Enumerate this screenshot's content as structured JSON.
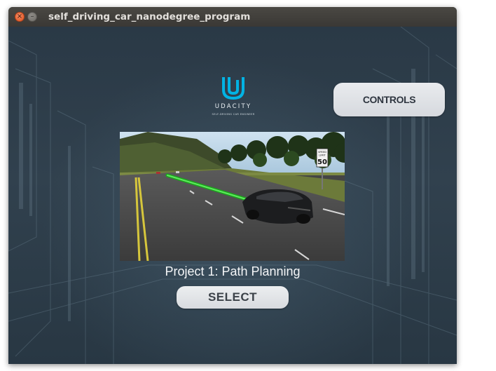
{
  "window": {
    "title": "self_driving_car_nanodegree_program",
    "close_glyph": "×",
    "minimize_glyph": "–"
  },
  "brand": {
    "name": "UDACITY",
    "tagline": "SELF-DRIVING CAR ENGINEER",
    "logo_color": "#02b3e4"
  },
  "controls_button": {
    "label": "CONTROLS"
  },
  "preview": {
    "speed_sign": {
      "line1": "SPEED",
      "line2": "LIMIT",
      "value": "50"
    }
  },
  "project": {
    "title": "Project 1: Path Planning",
    "select_label": "SELECT"
  },
  "icons": [
    "close-icon",
    "minimize-icon",
    "udacity-logo-icon"
  ]
}
